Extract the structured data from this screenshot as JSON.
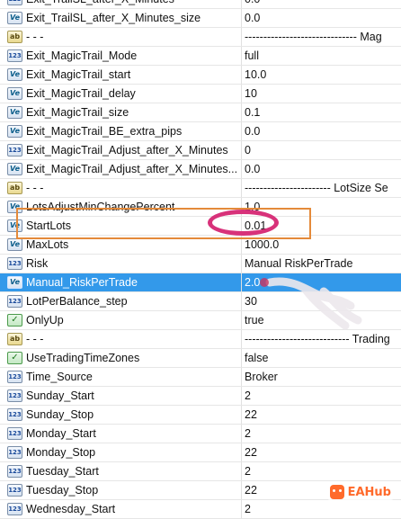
{
  "rows": [
    {
      "icon": "123",
      "name": "Exit_TrailSL_after_X_Minutes",
      "value": "0.0",
      "partial": true
    },
    {
      "icon": "Ve",
      "name": "Exit_TrailSL_after_X_Minutes_size",
      "value": "0.0"
    },
    {
      "icon": "ab",
      "name": "- - -",
      "value": "------------------------------ Mag",
      "section": true
    },
    {
      "icon": "123",
      "name": "Exit_MagicTrail_Mode",
      "value": "full"
    },
    {
      "icon": "Ve",
      "name": "Exit_MagicTrail_start",
      "value": "10.0"
    },
    {
      "icon": "Ve",
      "name": "Exit_MagicTrail_delay",
      "value": "10"
    },
    {
      "icon": "Ve",
      "name": "Exit_MagicTrail_size",
      "value": "0.1"
    },
    {
      "icon": "Ve",
      "name": "Exit_MagicTrail_BE_extra_pips",
      "value": "0.0"
    },
    {
      "icon": "123",
      "name": "Exit_MagicTrail_Adjust_after_X_Minutes",
      "value": "0"
    },
    {
      "icon": "Ve",
      "name": "Exit_MagicTrail_Adjust_after_X_Minutes...",
      "value": "0.0"
    },
    {
      "icon": "ab",
      "name": "- - -",
      "value": "----------------------- LotSize Se",
      "section": true
    },
    {
      "icon": "Ve",
      "name": "LotsAdjustMinChangePercent",
      "value": "1.0"
    },
    {
      "icon": "Ve",
      "name": "StartLots",
      "value": "0.01"
    },
    {
      "icon": "Ve",
      "name": "MaxLots",
      "value": "1000.0"
    },
    {
      "icon": "123",
      "name": "Risk",
      "value": "Manual RiskPerTrade"
    },
    {
      "icon": "Ve",
      "name": "Manual_RiskPerTrade",
      "value": "2.0",
      "selected": true
    },
    {
      "icon": "123",
      "name": "LotPerBalance_step",
      "value": "30"
    },
    {
      "icon": "bool",
      "name": "OnlyUp",
      "value": "true"
    },
    {
      "icon": "ab",
      "name": "- - -",
      "value": "---------------------------- Trading",
      "section": true
    },
    {
      "icon": "bool",
      "name": "UseTradingTimeZones",
      "value": "false"
    },
    {
      "icon": "123",
      "name": "Time_Source",
      "value": "Broker"
    },
    {
      "icon": "123",
      "name": "Sunday_Start",
      "value": "2"
    },
    {
      "icon": "123",
      "name": "Sunday_Stop",
      "value": "22"
    },
    {
      "icon": "123",
      "name": "Monday_Start",
      "value": "2"
    },
    {
      "icon": "123",
      "name": "Monday_Stop",
      "value": "22"
    },
    {
      "icon": "123",
      "name": "Tuesday_Start",
      "value": "2"
    },
    {
      "icon": "123",
      "name": "Tuesday_Stop",
      "value": "22"
    },
    {
      "icon": "123",
      "name": "Wednesday_Start",
      "value": "2",
      "partial": true
    }
  ],
  "watermark": {
    "text": "EAHub"
  },
  "colors": {
    "selection": "#3399ea",
    "highlight_box": "#e48a3a",
    "circle_mark": "#d8327a"
  }
}
